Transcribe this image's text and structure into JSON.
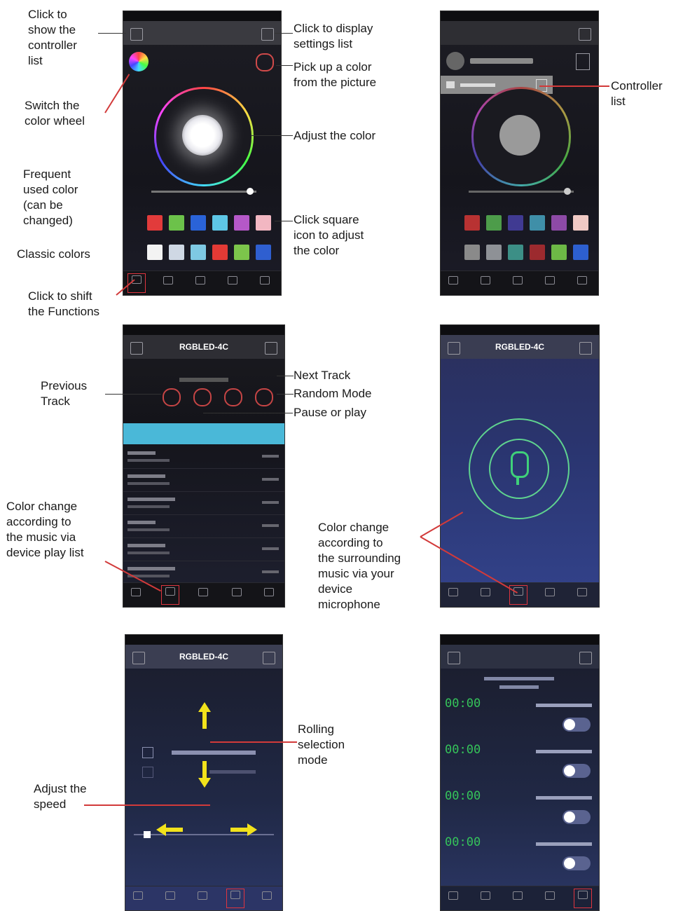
{
  "screens": {
    "s3_title": "RGBLED-4C",
    "s3_tracks": [
      "Previous Track",
      "Next Track"
    ]
  },
  "screen3": {
    "title": "RGBLED-4C"
  },
  "screen4": {
    "title": "RGBLED-4C"
  },
  "screen5": {
    "title": "RGBLED-4C"
  },
  "screen6": {
    "times": [
      "00:00",
      "00:00",
      "00:00",
      "00:00"
    ]
  },
  "annotations": {
    "show_controller_list": "Click to\nshow the\ncontroller\nlist",
    "switch_color_wheel": "Switch the\ncolor wheel",
    "frequent_color": "Frequent\nused color\n(can be\nchanged)",
    "classic_colors": "Classic colors",
    "shift_functions": "Click to shift\nthe Functions",
    "display_settings": "Click to display\nsettings list",
    "pick_color": "Pick up a color\nfrom the picture",
    "adjust_color": "Adjust the color",
    "click_square": "Click square\nicon to adjust\nthe color",
    "controller_list": "Controller\nlist",
    "previous_track": "Previous\nTrack",
    "next_track": "Next Track",
    "random_mode": "Random Mode",
    "pause_play": "Pause or play",
    "music_playlist": "Color change\naccording to\nthe music via\ndevice play list",
    "music_microphone": "Color change\naccording to\nthe surrounding\nmusic via your\ndevice\nmicrophone",
    "rolling_selection": "Rolling\nselection\nmode",
    "adjust_speed": "Adjust the\nspeed"
  },
  "colors": {
    "frequent": [
      "#e23b3b",
      "#6cc24a",
      "#2a63d8",
      "#5ec6e6",
      "#b558c8",
      "#f2b7c2"
    ],
    "classic": [
      "#f3f3f3",
      "#cfd8e4",
      "#7ec9e3",
      "#e33a35",
      "#7cc54b",
      "#2f5fd0"
    ],
    "frequent_dim": [
      "#b83232",
      "#4d9c4a",
      "#403a92",
      "#3f8fa8",
      "#8d4aa6",
      "#f0c9c4"
    ],
    "classic_dim": [
      "#8a8a8a",
      "#8e9196",
      "#3c8f86",
      "#9c2a2e",
      "#6db846",
      "#2d5fcf"
    ],
    "accent_red": "#d23a3a",
    "playlist_header": "#4ab8d8",
    "mic_green": "#3fd07a"
  }
}
